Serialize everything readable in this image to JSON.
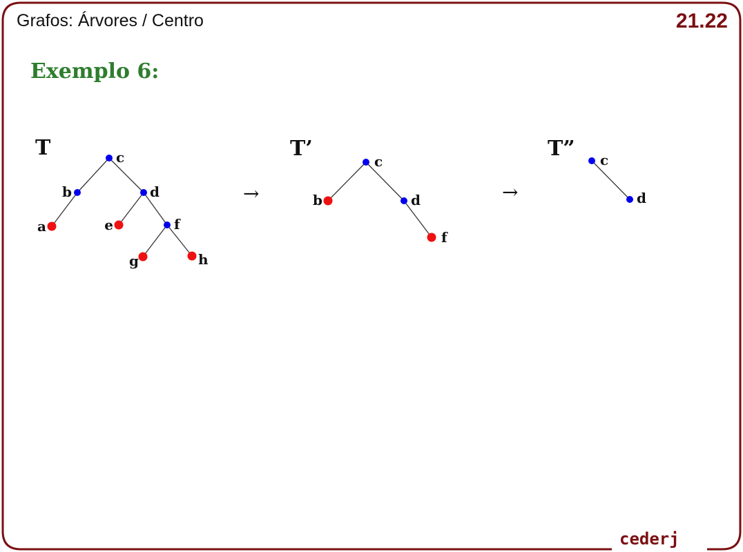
{
  "header": {
    "title": "Grafos: Árvores / Centro",
    "slide_number": "21.22"
  },
  "heading": "Exemplo 6:",
  "footer": {
    "logo_text": "cederj"
  },
  "colors": {
    "frame": "#7a0f12",
    "heading": "#2e7d2e",
    "internal_node": "#0000ee",
    "leaf_node": "#ee1111",
    "edge": "#333333"
  },
  "arrows": [
    "→",
    "→"
  ],
  "trees": [
    {
      "name": "T",
      "nodes": [
        {
          "id": "c",
          "label": "c",
          "type": "internal"
        },
        {
          "id": "b",
          "label": "b",
          "type": "internal"
        },
        {
          "id": "d",
          "label": "d",
          "type": "internal"
        },
        {
          "id": "a",
          "label": "a",
          "type": "leaf"
        },
        {
          "id": "e",
          "label": "e",
          "type": "leaf"
        },
        {
          "id": "f",
          "label": "f",
          "type": "internal"
        },
        {
          "id": "g",
          "label": "g",
          "type": "leaf"
        },
        {
          "id": "h",
          "label": "h",
          "type": "leaf"
        }
      ],
      "edges": [
        [
          "c",
          "b"
        ],
        [
          "c",
          "d"
        ],
        [
          "b",
          "a"
        ],
        [
          "d",
          "e"
        ],
        [
          "d",
          "f"
        ],
        [
          "f",
          "g"
        ],
        [
          "f",
          "h"
        ]
      ]
    },
    {
      "name": "T’",
      "nodes": [
        {
          "id": "c",
          "label": "c",
          "type": "internal"
        },
        {
          "id": "b",
          "label": "b",
          "type": "leaf"
        },
        {
          "id": "d",
          "label": "d",
          "type": "internal"
        },
        {
          "id": "f",
          "label": "f",
          "type": "leaf"
        }
      ],
      "edges": [
        [
          "c",
          "b"
        ],
        [
          "c",
          "d"
        ],
        [
          "d",
          "f"
        ]
      ]
    },
    {
      "name": "T”",
      "nodes": [
        {
          "id": "c",
          "label": "c",
          "type": "internal"
        },
        {
          "id": "d",
          "label": "d",
          "type": "internal"
        }
      ],
      "edges": [
        [
          "c",
          "d"
        ]
      ]
    }
  ]
}
